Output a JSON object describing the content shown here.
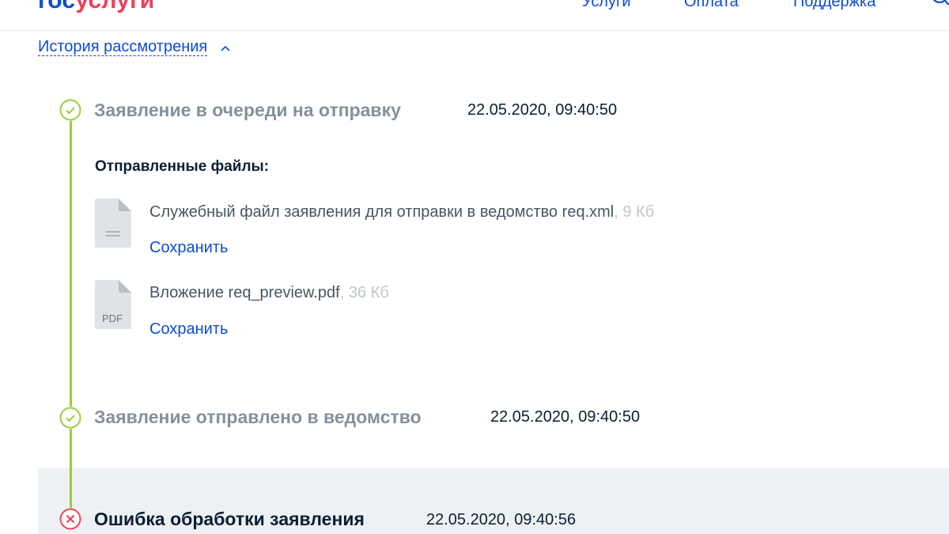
{
  "header": {
    "logo_part1": "гос",
    "logo_part2": "услуги",
    "nav": [
      "Услуги",
      "Оплата",
      "Поддержка"
    ]
  },
  "history": {
    "toggle_label": "История рассмотрения"
  },
  "events": [
    {
      "title": "Заявление в очереди на отправку",
      "date": "22.05.2020, 09:40:50",
      "status": "done"
    },
    {
      "title": "Заявление отправлено в ведомство",
      "date": "22.05.2020, 09:40:50",
      "status": "done"
    },
    {
      "title": "Ошибка обработки заявления",
      "date": "22.05.2020, 09:40:56",
      "status": "error"
    }
  ],
  "files": {
    "heading": "Отправленные файлы:",
    "items": [
      {
        "name": "Служебный файл заявления для отправки в ведомство req.xml",
        "size": ", 9 Кб",
        "save_label": "Сохранить",
        "icon": "document-icon"
      },
      {
        "name": "Вложение req_preview.pdf",
        "size": ", 36 Кб",
        "save_label": "Сохранить",
        "icon_text": "PDF",
        "icon": "pdf-file-icon"
      }
    ]
  },
  "colors": {
    "link": "#0d4cd3",
    "success": "#9ccc3c",
    "error": "#ee3f58",
    "muted": "#86909c"
  }
}
